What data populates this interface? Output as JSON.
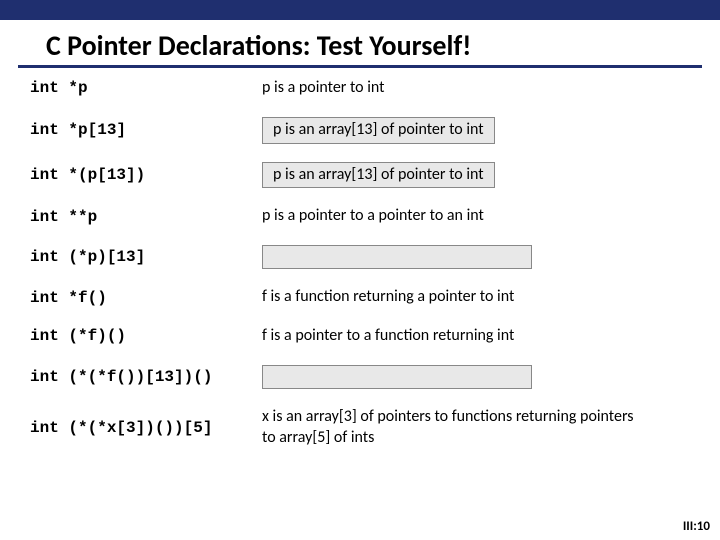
{
  "title": "C Pointer Declarations: Test Yourself!",
  "rows": [
    {
      "code": "int *p",
      "expl": "p is a pointer to int",
      "style": "plain"
    },
    {
      "code": "int *p[13]",
      "expl": "p is an array[13] of pointer to int",
      "style": "boxed"
    },
    {
      "code": "int *(p[13])",
      "expl": "p is an array[13] of pointer to int",
      "style": "boxed"
    },
    {
      "code": "int **p",
      "expl": "p is a pointer to a pointer to an int",
      "style": "plain"
    },
    {
      "code": "int (*p)[13]",
      "expl": "",
      "style": "hidden"
    },
    {
      "code": "int *f()",
      "expl": "f is a function returning a pointer to int",
      "style": "plain"
    },
    {
      "code": "int (*f)()",
      "expl": "f is a pointer to a function returning int",
      "style": "plain"
    },
    {
      "code": "int (*(*f())[13])()",
      "expl": "",
      "style": "hidden"
    },
    {
      "code": "int (*(*x[3])())[5]",
      "expl": "x is an array[3] of pointers  to functions returning pointers to array[5] of ints",
      "style": "plain"
    }
  ],
  "pagenum": "III:10"
}
